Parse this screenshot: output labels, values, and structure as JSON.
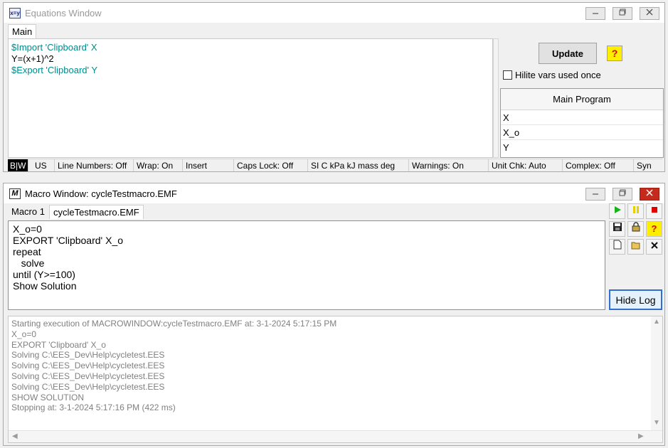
{
  "equations_window": {
    "title": "Equations Window",
    "icon_text": "x=y",
    "tab": "Main",
    "lines": [
      "$Import 'Clipboard' X",
      "Y=(x+1)^2",
      "$Export 'Clipboard' Y"
    ],
    "update_label": "Update",
    "help_label": "?",
    "hilite_label": "Hilite vars used once",
    "var_panel_title": "Main Program",
    "variables": [
      "X",
      "X_o",
      "Y"
    ],
    "status": {
      "bw": "B|W",
      "units": "US",
      "line_numbers": "Line Numbers: Off",
      "wrap": "Wrap: On",
      "insert": "Insert",
      "caps_lock": "Caps Lock: Off",
      "unit_system": "SI C kPa kJ mass deg",
      "warnings": "Warnings: On",
      "unit_check": "Unit Chk: Auto",
      "complex": "Complex: Off",
      "syntax": "Syn"
    }
  },
  "macro_window": {
    "title": "Macro Window: cycleTestmacro.EMF",
    "icon_text": "M",
    "tabs": [
      "Macro 1",
      "cycleTestmacro.EMF"
    ],
    "code": "X_o=0\nEXPORT 'Clipboard' X_o\nrepeat\n   solve\nuntil (Y>=100)\nShow Solution",
    "hide_log_label": "Hide Log",
    "log": "Starting execution of MACROWINDOW:cycleTestmacro.EMF at: 3-1-2024 5:17:15 PM\nX_o=0\nEXPORT 'Clipboard' X_o\nSolving C:\\EES_Dev\\Help\\cycletest.EES\nSolving C:\\EES_Dev\\Help\\cycletest.EES\nSolving C:\\EES_Dev\\Help\\cycletest.EES\nSolving C:\\EES_Dev\\Help\\cycletest.EES\nSHOW SOLUTION\nStopping at: 3-1-2024 5:17:16 PM (422 ms)"
  },
  "colors": {
    "teal_text": "#008b8b",
    "close_red": "#c42b1c",
    "help_yellow": "#ffee00",
    "run_green": "#19b319",
    "stop_red": "#e00000",
    "focus_blue": "#2f6fd1"
  }
}
